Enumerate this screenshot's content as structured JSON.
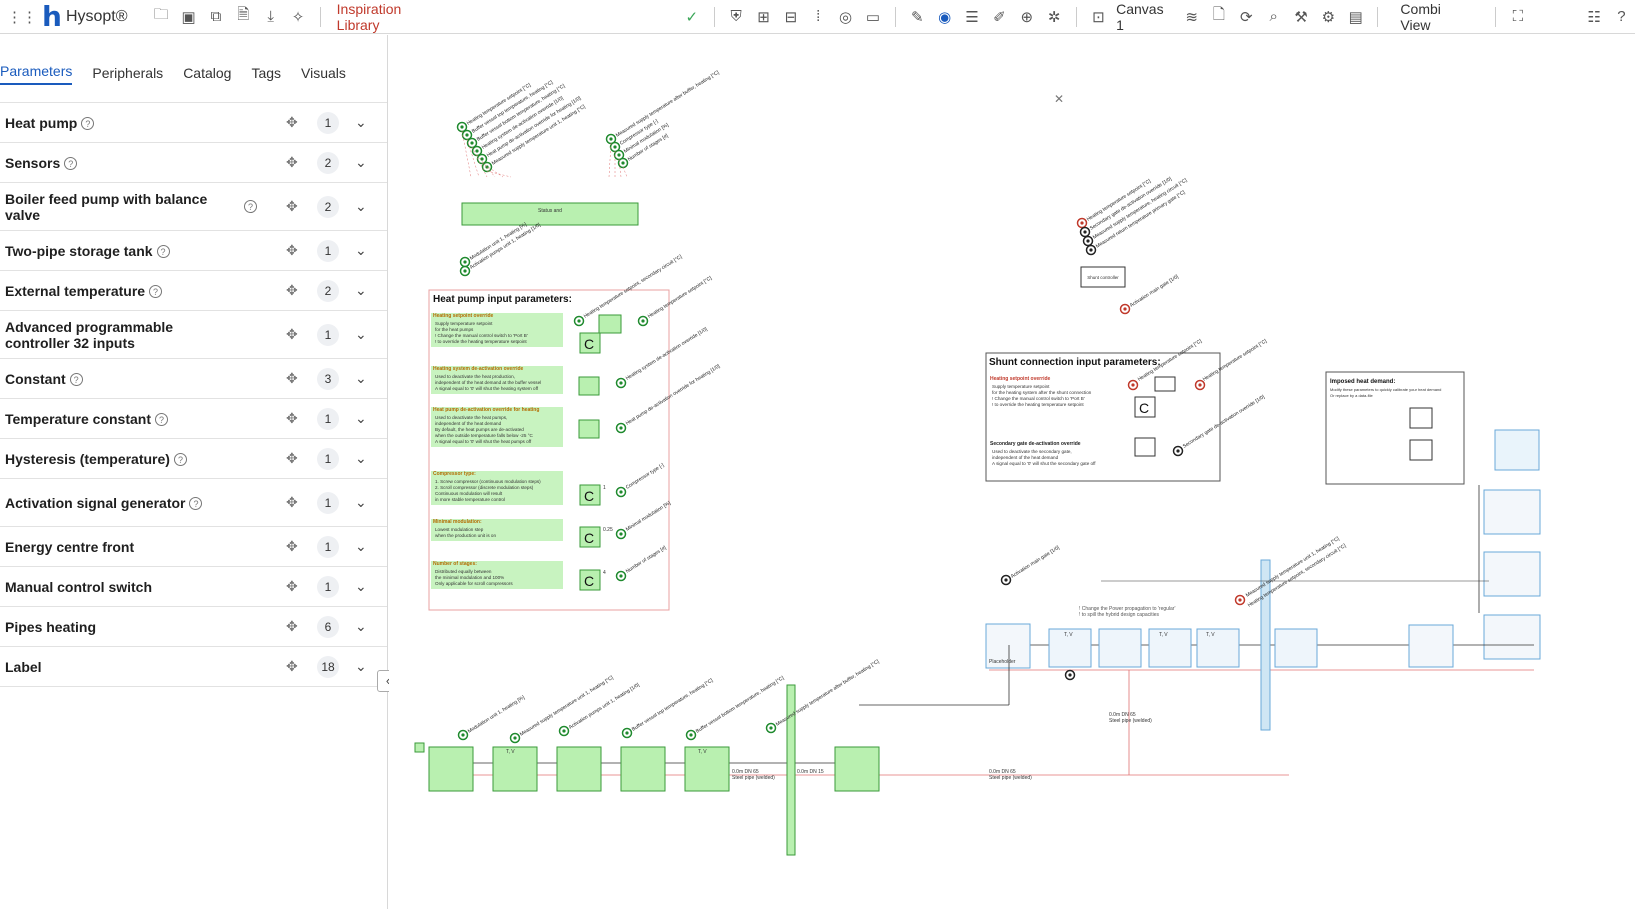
{
  "app": {
    "name": "Hysopt®",
    "library_link": "Inspiration Library",
    "canvas_label": "Canvas 1",
    "view_label": "Combi View"
  },
  "toolbar": {
    "icons": [
      "apps-icon",
      "folder-icon",
      "save-icon",
      "copy-icon",
      "file-settings-icon",
      "download-icon",
      "sparkle-icon",
      "check-circle-icon",
      "shield-icon",
      "compare-icon",
      "toolbox-icon",
      "grid-dots-icon",
      "target-icon",
      "monitor-chart-icon",
      "edit-icon",
      "location-icon",
      "sliders-icon",
      "pen-icon",
      "zoom-icon",
      "bug-icon",
      "canvas-icon",
      "layers-icon",
      "document-icon",
      "refresh-icon",
      "search-icon",
      "wrench-icon",
      "gear-icon",
      "notes-icon",
      "network-icon",
      "list-icon",
      "help-icon"
    ]
  },
  "sidebar": {
    "tabs": [
      "Parameters",
      "Peripherals",
      "Catalog",
      "Tags",
      "Visuals"
    ],
    "active_tab": "Parameters",
    "items": [
      {
        "label": "Heat pump",
        "count": "1",
        "help": "inline"
      },
      {
        "label": "Sensors",
        "count": "2",
        "help": "inline"
      },
      {
        "label": "Boiler feed pump with balance valve",
        "count": "2",
        "help": "right"
      },
      {
        "label": "Two-pipe storage tank",
        "count": "1",
        "help": "inline"
      },
      {
        "label": "External temperature",
        "count": "2",
        "help": "inline"
      },
      {
        "label": "Advanced programmable controller 32 inputs",
        "count": "1",
        "help": "none"
      },
      {
        "label": "Constant",
        "count": "3",
        "help": "inline"
      },
      {
        "label": "Temperature constant",
        "count": "1",
        "help": "inline"
      },
      {
        "label": "Hysteresis (temperature)",
        "count": "1",
        "help": "inline"
      },
      {
        "label": "Activation signal generator",
        "count": "1",
        "help": "inline"
      },
      {
        "label": "Energy centre front",
        "count": "1",
        "help": "none"
      },
      {
        "label": "Manual control switch",
        "count": "1",
        "help": "none"
      },
      {
        "label": "Pipes heating",
        "count": "6",
        "help": "none"
      },
      {
        "label": "Label",
        "count": "18",
        "help": "none"
      }
    ]
  },
  "canvas": {
    "hp_panel_title": "Heat pump input parameters:",
    "hp_sections": [
      {
        "title": "Heating setpoint override",
        "lines": [
          "Supply temperature setpoint",
          "for the heat pumps",
          "! Change the manual control switch to 'Port B'",
          "! to override the heating temperature setpoint"
        ]
      },
      {
        "title": "Heating system de-activation override",
        "lines": [
          "Used to deactivate the heat production,",
          "independent of the heat demand at the buffer vessel",
          "A signal equal to '0' will shut the heating system off"
        ]
      },
      {
        "title": "Heat pump de-activation override for heating",
        "lines": [
          "Used to deactivate the heat pumps,",
          "independent of the heat demand",
          "By default, the heat pumps are de-activated",
          "when the outside temperature falls below -25 °C",
          "A signal equal to '0' will shut the heat pumps off"
        ]
      },
      {
        "title": "Compressor type:",
        "lines": [
          "1. Screw compressor (continuous modulation steps)",
          "2. Scroll compressor (discrete modulation steps)",
          "Continuous modulation will result",
          "in more stable temperature control"
        ]
      },
      {
        "title": "Minimal modulation:",
        "lines": [
          "Lowest modulation step",
          "when the production unit is on"
        ]
      },
      {
        "title": "Number of stages:",
        "lines": [
          "Distributed equally between",
          "the minimal modulation and 100%",
          "Only applicable for scroll compressors"
        ]
      }
    ],
    "const_values": [
      "1",
      "0.25",
      "4"
    ],
    "shunt_panel_title": "Shunt connection input parameters:",
    "shunt_sections": [
      {
        "title": "Heating setpoint override",
        "lines": [
          "Supply temperature setpoint",
          "for the heating system after the shunt connection",
          "! Change the manual control switch to 'Port B'",
          "! to override the heating temperature setpoint"
        ]
      },
      {
        "title": "Secondary gate de-activation override",
        "lines": [
          "Used to deactivate the secondary gate,",
          "independent of the heat demand",
          "A signal equal to '0' will shut the secondary gate off"
        ]
      }
    ],
    "imposed_title": "Imposed heat demand:",
    "imposed_lines": [
      "Modify these parameters to quickly calibrate your heat demand",
      "Or replace by a data-file"
    ],
    "placeholder_label": "Placeholder",
    "pipe_label_a": "0.0m DN 65",
    "pipe_label_b": "Steel pipe (welded)",
    "pipe_label_c": "0.0m DN 15",
    "power_note": [
      "! Change the Power propagation to 'regular'",
      "! to spill the hybrid design capacities"
    ],
    "signal_labels_top": [
      "Heating temperature setpoint [°C]",
      "Buffer vessel top temperature, heating [°C]",
      "Buffer vessel bottom temperature, heating [°C]",
      "Heating system de-activation override [1/0]",
      "Heat pump de-activation override for heating [1/0]",
      "Measured supply temperature unit 1, heating [°C]"
    ],
    "signal_labels_right": [
      "Measured supply temperature after buffer, heating [°C]",
      "Compressor type [-]",
      "Minimal modulation [%]",
      "Number of stages [#]"
    ],
    "signal_labels_bottom": [
      "Modulation unit 1, heating [%]",
      "Measured supply temperature unit 1, heating [°C]",
      "Activation pumps unit 1, heating [1/0]",
      "Buffer vessel top temperature, heating [°C]",
      "Buffer vessel bottom temperature, heating [°C]",
      "Measured supply temperature after buffer, heating [°C]",
      "Heating temperature setpoint, secondary circuit [°C]"
    ],
    "shunt_signals": [
      "Heating temperature setpoint [°C]",
      "Secondary gate de-activation override [1/0]",
      "Measured supply temperature, heating circuit [°C]",
      "Measured return temperature primary gate [°C]"
    ],
    "activation_label": "Activation main gate [1/0]",
    "hp_signals": [
      "Heating temperature setpoint, secondary circuit [°C]",
      "Heating temperature setpoint [°C]",
      "Heating system de-activation override [1/0]",
      "Heat pump de-activation override for heating [1/0]",
      "Compressor type [-]",
      "Minimal modulation [%]",
      "Number of stages [#]"
    ],
    "controller_labels": [
      "Shunt controller",
      "Status and"
    ],
    "tv": "T, V",
    "tq": "T, dp Q"
  }
}
